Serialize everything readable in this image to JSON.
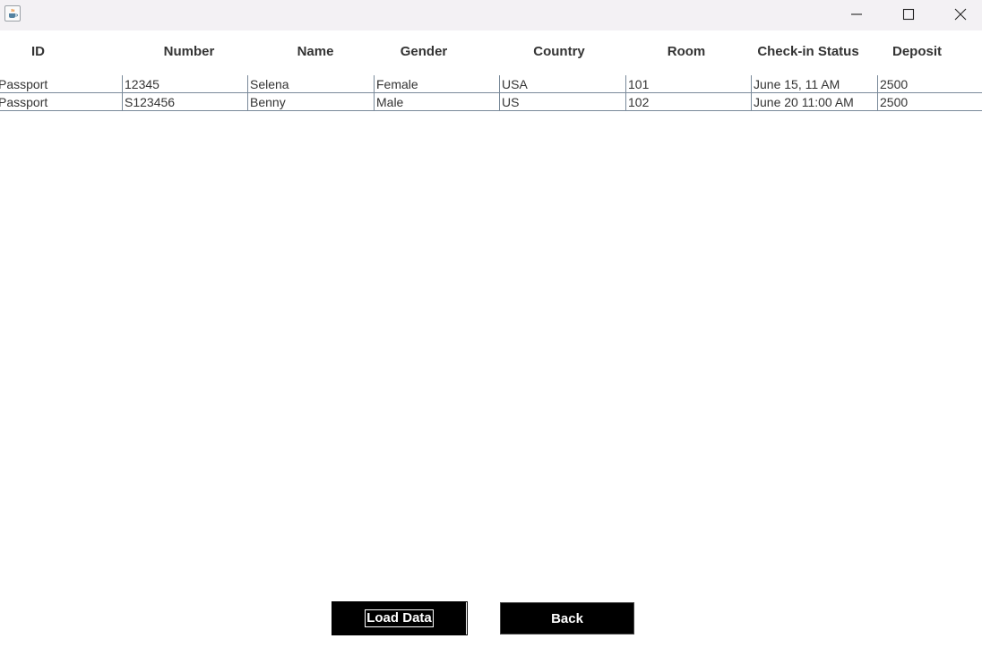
{
  "window": {
    "icon": "java-cup-icon"
  },
  "table": {
    "columns": [
      "ID",
      "Number",
      "Name",
      "Gender",
      "Country",
      "Room",
      "Check-in Status",
      "Deposit"
    ],
    "rows": [
      [
        "Passport",
        "12345",
        "Selena",
        "Female",
        "USA",
        "101",
        "June 15, 11 AM",
        "2500"
      ],
      [
        "Passport",
        "S123456",
        "Benny",
        "Male",
        "US",
        "102",
        "June 20 11:00 AM",
        "2500"
      ]
    ]
  },
  "buttons": {
    "load_label": "Load Data",
    "back_label": "Back"
  }
}
